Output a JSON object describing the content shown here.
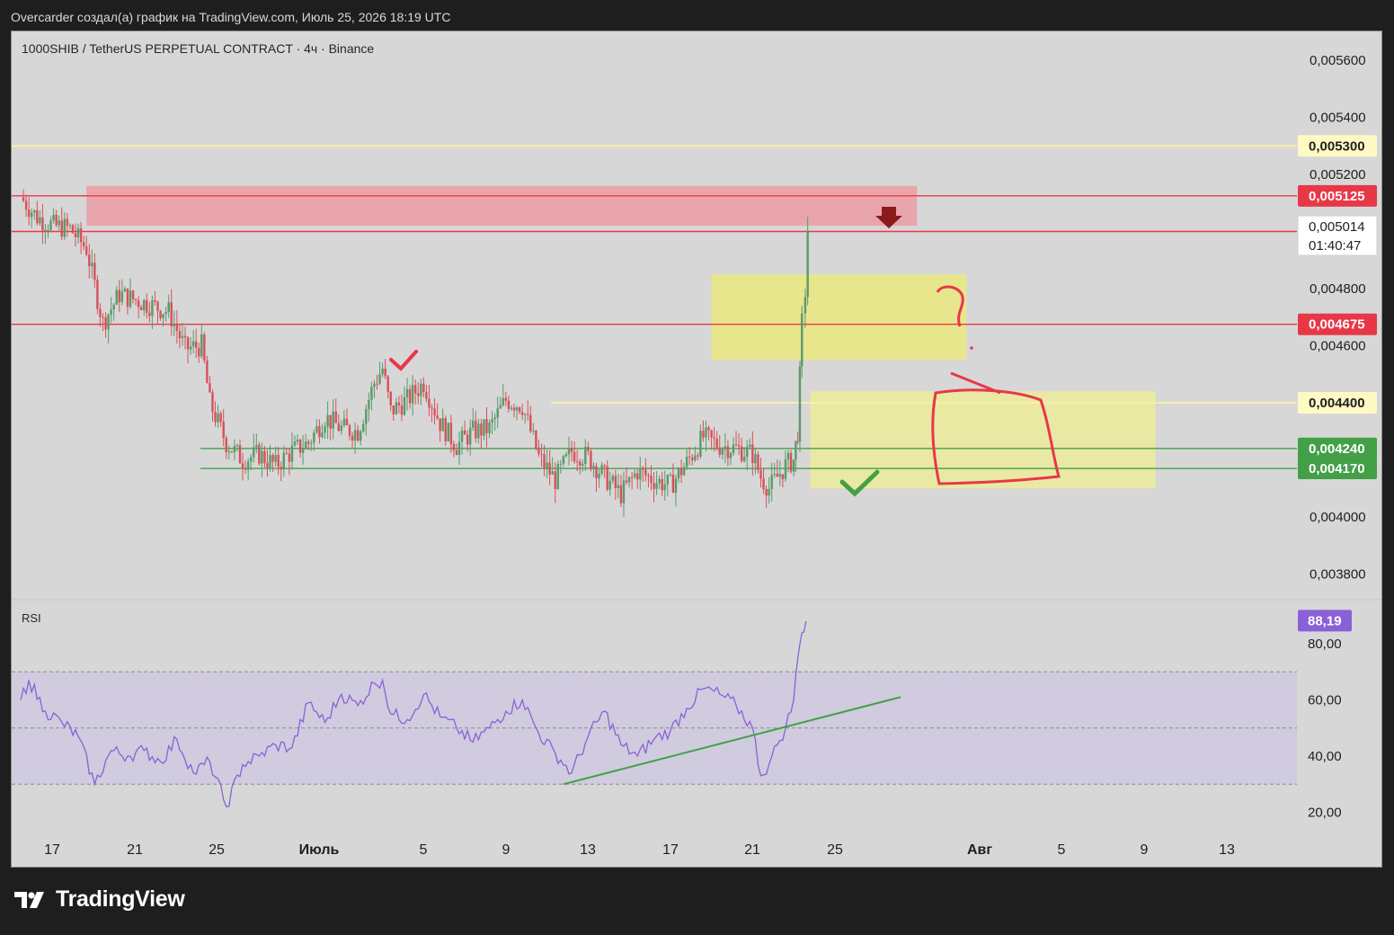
{
  "header": {
    "caption": "Overcarder создал(а) график на TradingView.com, Июль 25, 2026 18:19 UTC"
  },
  "brand": {
    "name": "TradingView",
    "logo_icon": "tradingview-logo-icon"
  },
  "colors": {
    "chart_bg": "#d7d7d7",
    "up": "#5a9a6a",
    "down": "#d8505a",
    "red_line": "#e83848",
    "green_line": "#43a047",
    "yellow_line": "#f5f0a8",
    "rsi": "#8a60d8",
    "rsi_band": "#d0cbde"
  },
  "chart_data": [
    {
      "type": "candlestick",
      "title": "1000SHIB / TetherUS PERPETUAL CONTRACT · 4ч · Binance",
      "y_axis": {
        "min": 0.0037,
        "max": 0.0057,
        "ticks": [
          "0,005600",
          "0,005400",
          "0,005200",
          "0,004800",
          "0,004600",
          "0,004000",
          "0,003800"
        ]
      },
      "x_axis": {
        "ticks": [
          "17",
          "21",
          "25",
          "Июль",
          "5",
          "9",
          "13",
          "17",
          "21",
          "25",
          "Авг",
          "5",
          "9",
          "13"
        ]
      },
      "price_path": [
        [
          0,
          0.00512
        ],
        [
          2,
          0.00505
        ],
        [
          4,
          0.00502
        ],
        [
          6,
          0.00501
        ],
        [
          8,
          0.00494
        ],
        [
          10,
          0.00468
        ],
        [
          12,
          0.00478
        ],
        [
          15,
          0.00475
        ],
        [
          18,
          0.00472
        ],
        [
          20,
          0.00459
        ],
        [
          22,
          0.0046
        ],
        [
          23,
          0.0044
        ],
        [
          25,
          0.00426
        ],
        [
          27,
          0.0042
        ],
        [
          29,
          0.00422
        ],
        [
          31,
          0.00418
        ],
        [
          33,
          0.00423
        ],
        [
          35,
          0.00426
        ],
        [
          37,
          0.00435
        ],
        [
          39,
          0.00431
        ],
        [
          41,
          0.0043
        ],
        [
          43,
          0.00447
        ],
        [
          44,
          0.00452
        ],
        [
          45,
          0.00437
        ],
        [
          47,
          0.00441
        ],
        [
          49,
          0.00447
        ],
        [
          51,
          0.00433
        ],
        [
          53,
          0.00425
        ],
        [
          55,
          0.0043
        ],
        [
          57,
          0.00431
        ],
        [
          59,
          0.00441
        ],
        [
          61,
          0.00439
        ],
        [
          63,
          0.00421
        ],
        [
          65,
          0.00413
        ],
        [
          67,
          0.00423
        ],
        [
          69,
          0.00421
        ],
        [
          71,
          0.00414
        ],
        [
          73,
          0.00408
        ],
        [
          75,
          0.00416
        ],
        [
          77,
          0.00413
        ],
        [
          79,
          0.00411
        ],
        [
          81,
          0.00419
        ],
        [
          83,
          0.00428
        ],
        [
          85,
          0.00425
        ],
        [
          87,
          0.00424
        ],
        [
          89,
          0.00422
        ],
        [
          90,
          0.00414
        ],
        [
          91,
          0.0041
        ],
        [
          92,
          0.00414
        ],
        [
          93,
          0.00418
        ],
        [
          94,
          0.0042
        ],
        [
          94.5,
          0.0043
        ],
        [
          95,
          0.00468
        ],
        [
          95.4,
          0.00479
        ],
        [
          95.7,
          0.00501
        ]
      ],
      "levels": [
        {
          "label": "0,005300",
          "value": 0.0053,
          "kind": "yellow"
        },
        {
          "label": "0,005125",
          "value": 0.005125,
          "kind": "red"
        },
        {
          "label": "0,005000",
          "value": 0.005,
          "kind": "red"
        },
        {
          "label": "0,004675",
          "value": 0.004675,
          "kind": "red"
        },
        {
          "label": "0,004400",
          "value": 0.0044,
          "kind": "yellow"
        },
        {
          "label": "0,004240",
          "value": 0.00424,
          "kind": "green"
        },
        {
          "label": "0,004170",
          "value": 0.00417,
          "kind": "green"
        }
      ],
      "current_price": {
        "label": "0,005014",
        "countdown": "01:40:47",
        "value": 0.005014
      },
      "zones": [
        {
          "name": "resistance-zone",
          "x": [
            8,
            109
          ],
          "y": [
            0.00502,
            0.00516
          ],
          "color": "#e9a2a8"
        },
        {
          "name": "target-zone-upper",
          "x": [
            84,
            115
          ],
          "y": [
            0.00455,
            0.00485
          ],
          "color": "#e9e787"
        },
        {
          "name": "support-zone",
          "x": [
            96,
            138
          ],
          "y": [
            0.0041,
            0.00444
          ],
          "color": "#ecea9e"
        }
      ]
    },
    {
      "type": "line",
      "title": "RSI",
      "y_axis": {
        "min": 15,
        "max": 92,
        "ticks": [
          "80,00",
          "60,00",
          "40,00",
          "20,00"
        ],
        "band": [
          30,
          70
        ],
        "mid": 50
      },
      "last_value": "88,19",
      "values": [
        [
          0,
          60
        ],
        [
          1,
          67
        ],
        [
          3,
          56
        ],
        [
          5,
          52
        ],
        [
          7,
          47
        ],
        [
          9,
          30
        ],
        [
          11,
          42
        ],
        [
          13,
          40
        ],
        [
          15,
          42
        ],
        [
          17,
          38
        ],
        [
          19,
          46
        ],
        [
          21,
          34
        ],
        [
          23,
          38
        ],
        [
          25,
          22
        ],
        [
          27,
          37
        ],
        [
          29,
          40
        ],
        [
          31,
          44
        ],
        [
          33,
          43
        ],
        [
          35,
          59
        ],
        [
          37,
          52
        ],
        [
          39,
          62
        ],
        [
          41,
          58
        ],
        [
          43,
          66
        ],
        [
          44,
          67
        ],
        [
          45,
          55
        ],
        [
          47,
          53
        ],
        [
          49,
          62
        ],
        [
          51,
          54
        ],
        [
          53,
          50
        ],
        [
          55,
          45
        ],
        [
          57,
          50
        ],
        [
          59,
          56
        ],
        [
          61,
          60
        ],
        [
          63,
          48
        ],
        [
          65,
          41
        ],
        [
          67,
          34
        ],
        [
          69,
          47
        ],
        [
          71,
          56
        ],
        [
          73,
          44
        ],
        [
          75,
          40
        ],
        [
          77,
          46
        ],
        [
          79,
          49
        ],
        [
          81,
          57
        ],
        [
          83,
          64
        ],
        [
          85,
          62
        ],
        [
          87,
          58
        ],
        [
          89,
          50
        ],
        [
          90,
          33
        ],
        [
          91,
          37
        ],
        [
          92,
          44
        ],
        [
          93,
          50
        ],
        [
          94,
          60
        ],
        [
          94.5,
          75
        ],
        [
          95,
          84
        ],
        [
          95.5,
          88
        ]
      ],
      "trendline": [
        [
          66,
          30
        ],
        [
          107,
          61
        ]
      ]
    }
  ]
}
